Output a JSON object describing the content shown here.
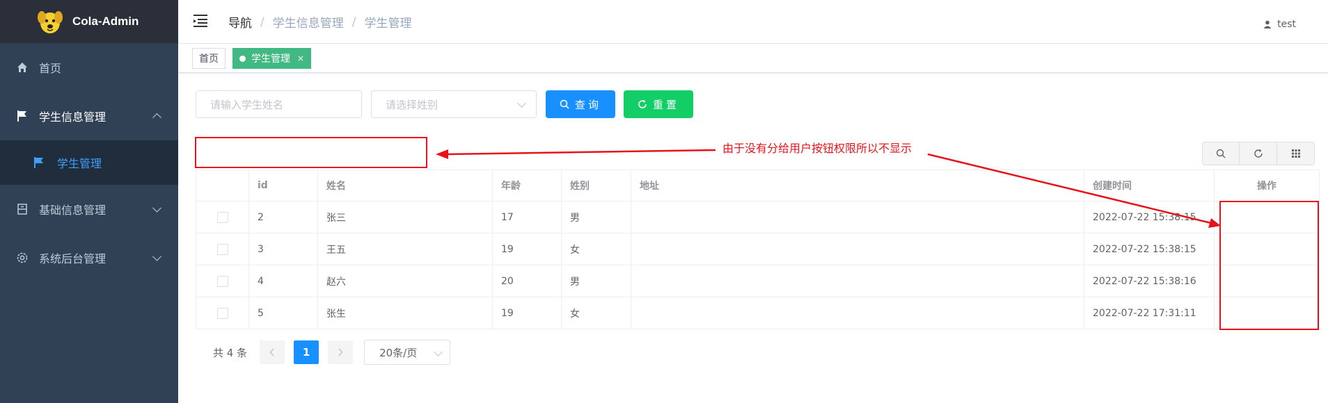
{
  "app": {
    "title": "Cola-Admin"
  },
  "sidebar": {
    "items": [
      {
        "label": "首页",
        "icon": "home-icon"
      },
      {
        "label": "学生信息管理",
        "icon": "flag-icon",
        "expanded": true
      },
      {
        "label": "学生管理",
        "icon": "flag-icon",
        "active": true
      },
      {
        "label": "基础信息管理",
        "icon": "table-icon"
      },
      {
        "label": "系统后台管理",
        "icon": "gear-icon"
      }
    ]
  },
  "header": {
    "breadcrumb": [
      "导航",
      "学生信息管理",
      "学生管理"
    ],
    "separator": "/",
    "user": "test"
  },
  "tags": [
    {
      "label": "首页"
    },
    {
      "label": "学生管理",
      "close": "×",
      "active": true
    }
  ],
  "filters": {
    "name_placeholder": "请输入学生姓名",
    "gender_placeholder": "请选择姓别",
    "search_label": "查询",
    "reset_label": "重置"
  },
  "table": {
    "columns": [
      "id",
      "姓名",
      "年龄",
      "姓别",
      "地址",
      "创建时间",
      "操作"
    ],
    "rows": [
      {
        "id": "2",
        "name": "张三",
        "age": "17",
        "gender": "男",
        "address": "",
        "created": "2022-07-22 15:38:15"
      },
      {
        "id": "3",
        "name": "王五",
        "age": "19",
        "gender": "女",
        "address": "",
        "created": "2022-07-22 15:38:15"
      },
      {
        "id": "4",
        "name": "赵六",
        "age": "20",
        "gender": "男",
        "address": "",
        "created": "2022-07-22 15:38:16"
      },
      {
        "id": "5",
        "name": "张生",
        "age": "19",
        "gender": "女",
        "address": "",
        "created": "2022-07-22 17:31:11"
      }
    ]
  },
  "pagination": {
    "total_text": "共 4 条",
    "current_page": "1",
    "page_size": "20条/页"
  },
  "annotation": {
    "text": "由于没有分给用户按钮权限所以不显示",
    "color": "#e8131a"
  },
  "colors": {
    "sidebar_bg": "#304156",
    "accent": "#1890ff",
    "success": "#13ce66",
    "tag_active": "#42b983"
  }
}
